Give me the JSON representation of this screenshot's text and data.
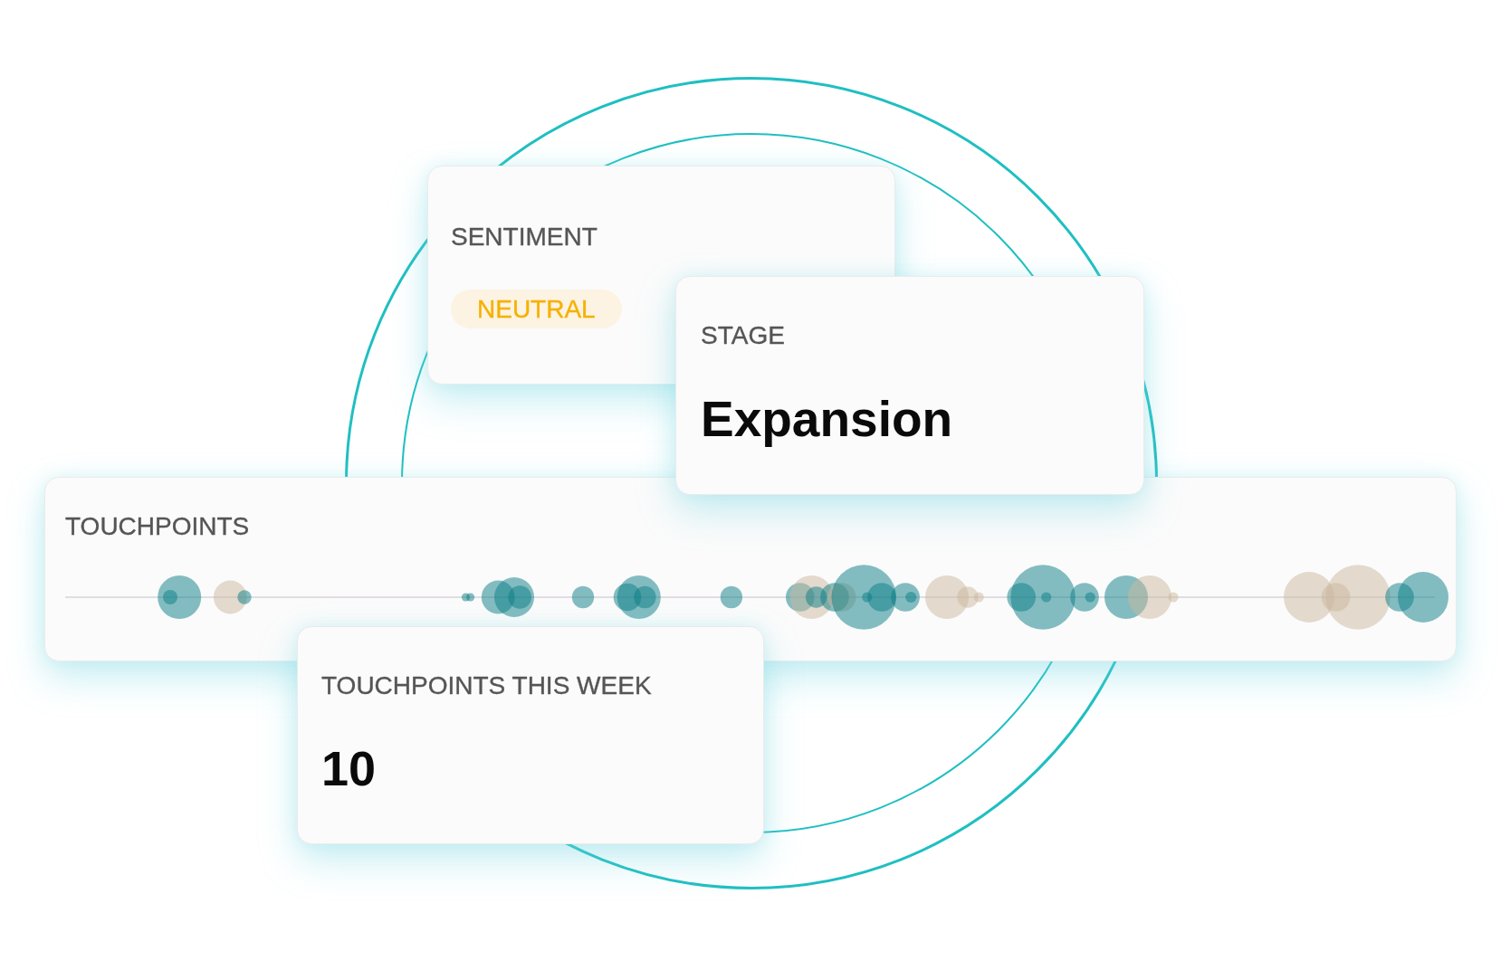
{
  "sentiment_card": {
    "label": "SENTIMENT",
    "badge": "NEUTRAL"
  },
  "stage_card": {
    "label": "STAGE",
    "value": "Expansion"
  },
  "touchpoints_card": {
    "label": "TOUCHPOINTS"
  },
  "touchpoints_this_week_card": {
    "label": "TOUCHPOINTS THIS WEEK",
    "value": "10"
  }
}
